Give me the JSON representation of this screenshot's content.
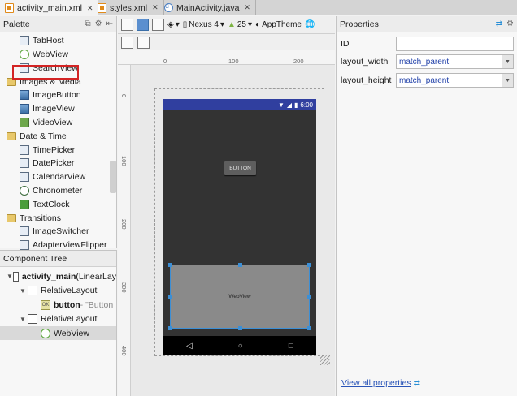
{
  "tabs": [
    {
      "label": "activity_main.xml",
      "icon": "xml-file-icon",
      "active": true
    },
    {
      "label": "styles.xml",
      "icon": "xml-file-icon",
      "active": false
    },
    {
      "label": "MainActivity.java",
      "icon": "java-class-icon",
      "active": false
    }
  ],
  "palette": {
    "title": "Palette",
    "items": [
      {
        "label": "TabHost",
        "kind": "widget"
      },
      {
        "label": "WebView",
        "kind": "web"
      },
      {
        "label": "SearchView",
        "kind": "search"
      },
      {
        "label": "Images & Media",
        "kind": "folder"
      },
      {
        "label": "ImageButton",
        "kind": "image"
      },
      {
        "label": "ImageView",
        "kind": "image"
      },
      {
        "label": "VideoView",
        "kind": "video"
      },
      {
        "label": "Date & Time",
        "kind": "folder"
      },
      {
        "label": "TimePicker",
        "kind": "widget"
      },
      {
        "label": "DatePicker",
        "kind": "widget"
      },
      {
        "label": "CalendarView",
        "kind": "widget"
      },
      {
        "label": "Chronometer",
        "kind": "clock"
      },
      {
        "label": "TextClock",
        "kind": "green"
      },
      {
        "label": "Transitions",
        "kind": "folder"
      },
      {
        "label": "ImageSwitcher",
        "kind": "widget"
      },
      {
        "label": "AdapterViewFlipper",
        "kind": "widget"
      }
    ]
  },
  "component_tree": {
    "title": "Component Tree",
    "items": [
      {
        "label": "activity_main",
        "suffix": " (LinearLay",
        "indent": 0
      },
      {
        "label": "RelativeLayout",
        "suffix": "",
        "indent": 1
      },
      {
        "label": "button",
        "suffix": " - \"Button",
        "indent": 2
      },
      {
        "label": "RelativeLayout",
        "suffix": "",
        "indent": 1
      },
      {
        "label": "WebView",
        "suffix": "",
        "indent": 2
      }
    ]
  },
  "toolbar": {
    "device": "Nexus 4",
    "api": "25",
    "theme": "AppTheme"
  },
  "rulers": {
    "h": [
      "0",
      "100",
      "200"
    ],
    "v": [
      "0",
      "100",
      "200",
      "300",
      "400"
    ]
  },
  "preview": {
    "status_time": "6:00",
    "button_label": "BUTTON",
    "webview_label": "WebView"
  },
  "properties": {
    "title": "Properties",
    "id_label": "ID",
    "id_value": "",
    "layout_width_label": "layout_width",
    "layout_width_value": "match_parent",
    "layout_height_label": "layout_height",
    "layout_height_value": "match_parent",
    "view_all": "View all properties"
  }
}
